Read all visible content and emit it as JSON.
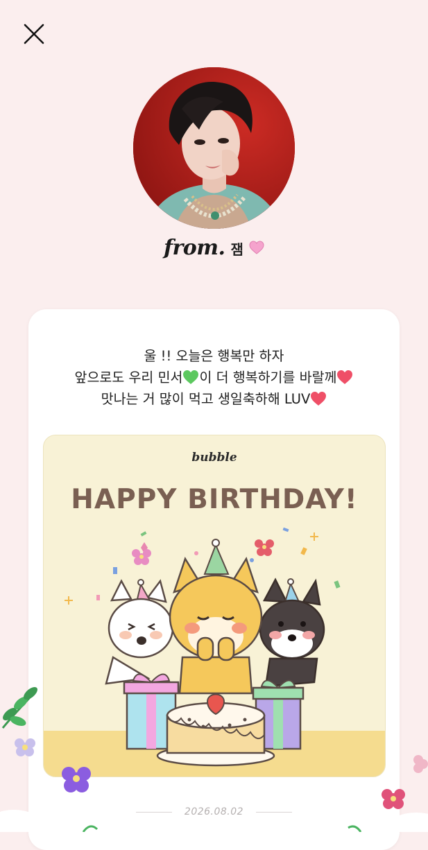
{
  "close": {
    "icon": "close-icon"
  },
  "profile": {
    "from_label": "from.",
    "name": "잼",
    "name_icon": "pink-heart-icon"
  },
  "message": {
    "line1": "울       !! 오늘은 행복만 하자",
    "line2_a": "앞으로도 우리 민서",
    "line2_b": "이 더 행복하기를 바랄께",
    "line3": "맛나는 거 많이 먹고 생일축하해 LUV"
  },
  "card": {
    "brand": "bubble",
    "title": "HAPPY BIRTHDAY!"
  },
  "date": "2026.08.02",
  "colors": {
    "background": "#fbeeee",
    "accent_pink": "#ef4f67",
    "accent_green": "#58c35a",
    "card_bg": "#f8f2d6",
    "title_brown": "#7a5f52"
  }
}
